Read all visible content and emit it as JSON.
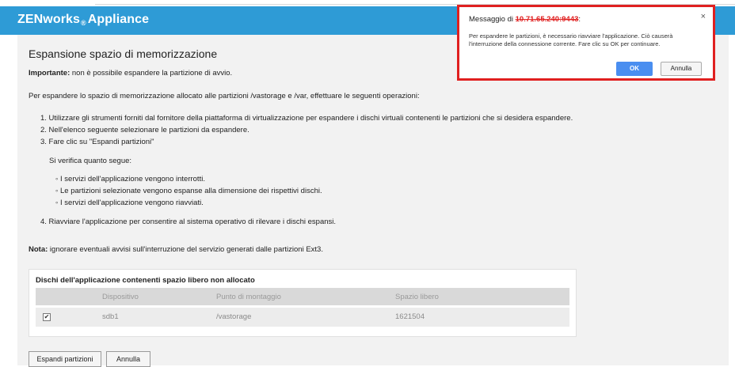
{
  "header": {
    "title": "ZENworks",
    "reg": "®",
    "title_suffix": "Appliance"
  },
  "main": {
    "title": "Espansione spazio di memorizzazione",
    "important_label": "Importante:",
    "important_text": " non è possibile espandere la partizione di avvio.",
    "intro": "Per espandere lo spazio di memorizzazione allocato alle partizioni /vastorage e /var, effettuare le seguenti operazioni:",
    "steps": [
      "1. Utilizzare gli strumenti forniti dal fornitore della piattaforma di virtualizzazione per espandere i dischi virtuali contenenti le partizioni che si desidera espandere.",
      "2. Nell'elenco seguente selezionare le partizioni da espandere.",
      "3. Fare clic su \"Espandi partizioni\""
    ],
    "occurs_label": "Si verifica quanto segue:",
    "bullets": [
      "I servizi dell'applicazione vengono interrotti.",
      "Le partizioni selezionate vengono espanse alla dimensione dei rispettivi dischi.",
      "I servizi dell'applicazione vengono riavviati."
    ],
    "bullet_glyph": "◦",
    "step4": "4. Riavviare l'applicazione per consentire al sistema operativo di rilevare i dischi espansi.",
    "note_label": "Nota:",
    "note_text": " ignorare eventuali avvisi sull'interruzione del servizio generati dalle partizioni Ext3."
  },
  "table": {
    "title": "Dischi dell'applicazione contenenti spazio libero non allocato",
    "columns": [
      "Dispositivo",
      "Punto di montaggio",
      "Spazio libero"
    ],
    "rows": [
      {
        "checked": "✔",
        "device": "sdb1",
        "mount": "/vastorage",
        "free": "1621504"
      }
    ]
  },
  "buttons": {
    "expand": "Espandi partizioni",
    "cancel": "Annulla"
  },
  "dialog": {
    "title_prefix": "Messaggio di ",
    "title_redacted": "10.71.65.240:9443",
    "title_suffix": ":",
    "close": "×",
    "message": "Per espandere le partizioni, è necessario riavviare l'applicazione. Ciò causerà l'interruzione della connessione corrente. Fare clic su OK per continuare.",
    "ok": "OK",
    "cancel": "Annulla"
  },
  "colors": {
    "header": "#2e9bd6",
    "dialog_border": "#e02020",
    "ok_button": "#4a8ef0"
  }
}
